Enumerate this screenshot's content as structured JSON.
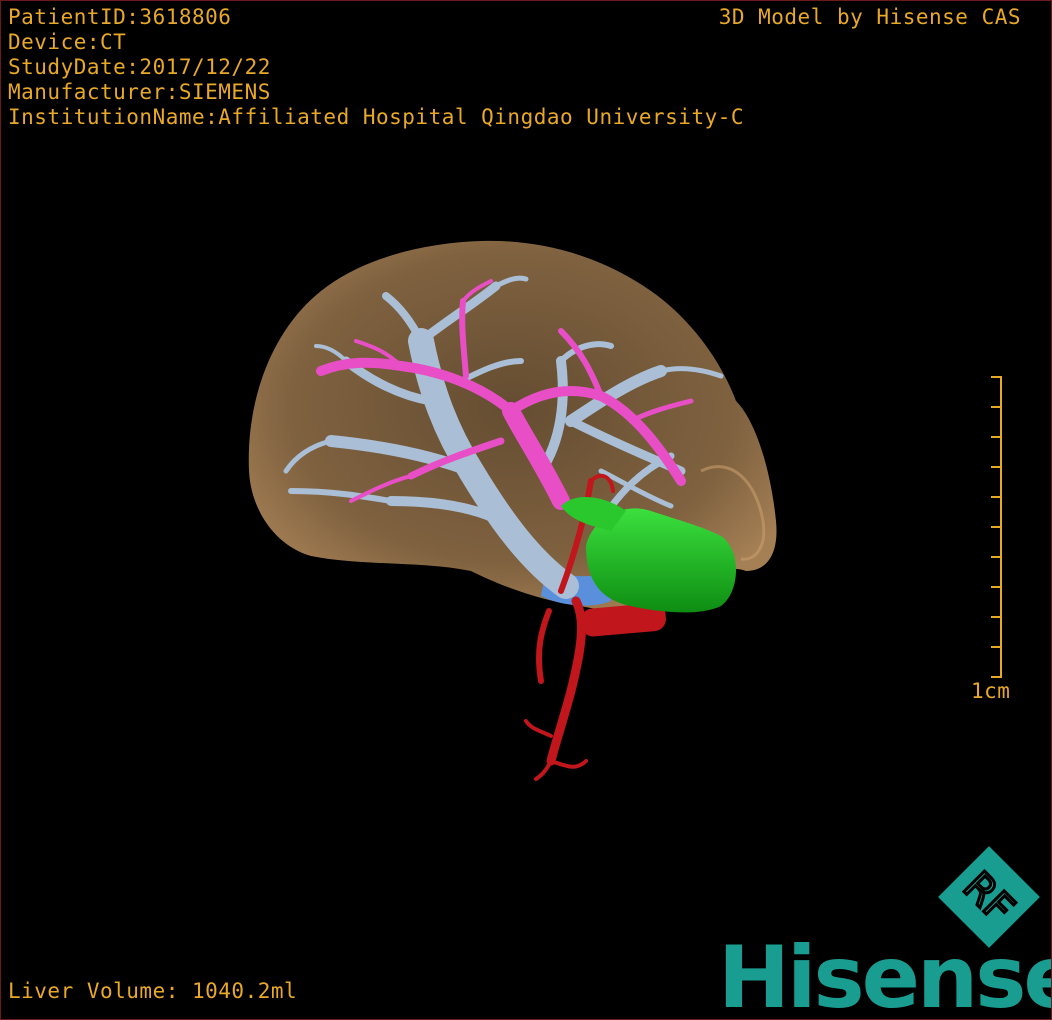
{
  "overlay": {
    "patient": "PatientID:3618806",
    "device": "Device:CT",
    "study_date": "StudyDate:2017/12/22",
    "manufacturer": "Manufacturer:SIEMENS",
    "institution": "InstitutionName:Affiliated Hospital Qingdao University-C",
    "credit": "3D Model by Hisense CAS",
    "liver_volume": "Liver Volume: 1040.2ml"
  },
  "scale_bar": {
    "label": "1cm",
    "ticks": 10
  },
  "logo": {
    "badge": "RF",
    "brand": "Hisense"
  },
  "colors": {
    "overlay_text": "#e8a828",
    "liver": "#b38a5c",
    "hepatic_vein": "#aabfd6",
    "portal_vein": "#e84fc6",
    "artery": "#c0161c",
    "gallbladder": "#19c21c",
    "ivc": "#5a8fdc",
    "brand": "#1a9d91"
  }
}
